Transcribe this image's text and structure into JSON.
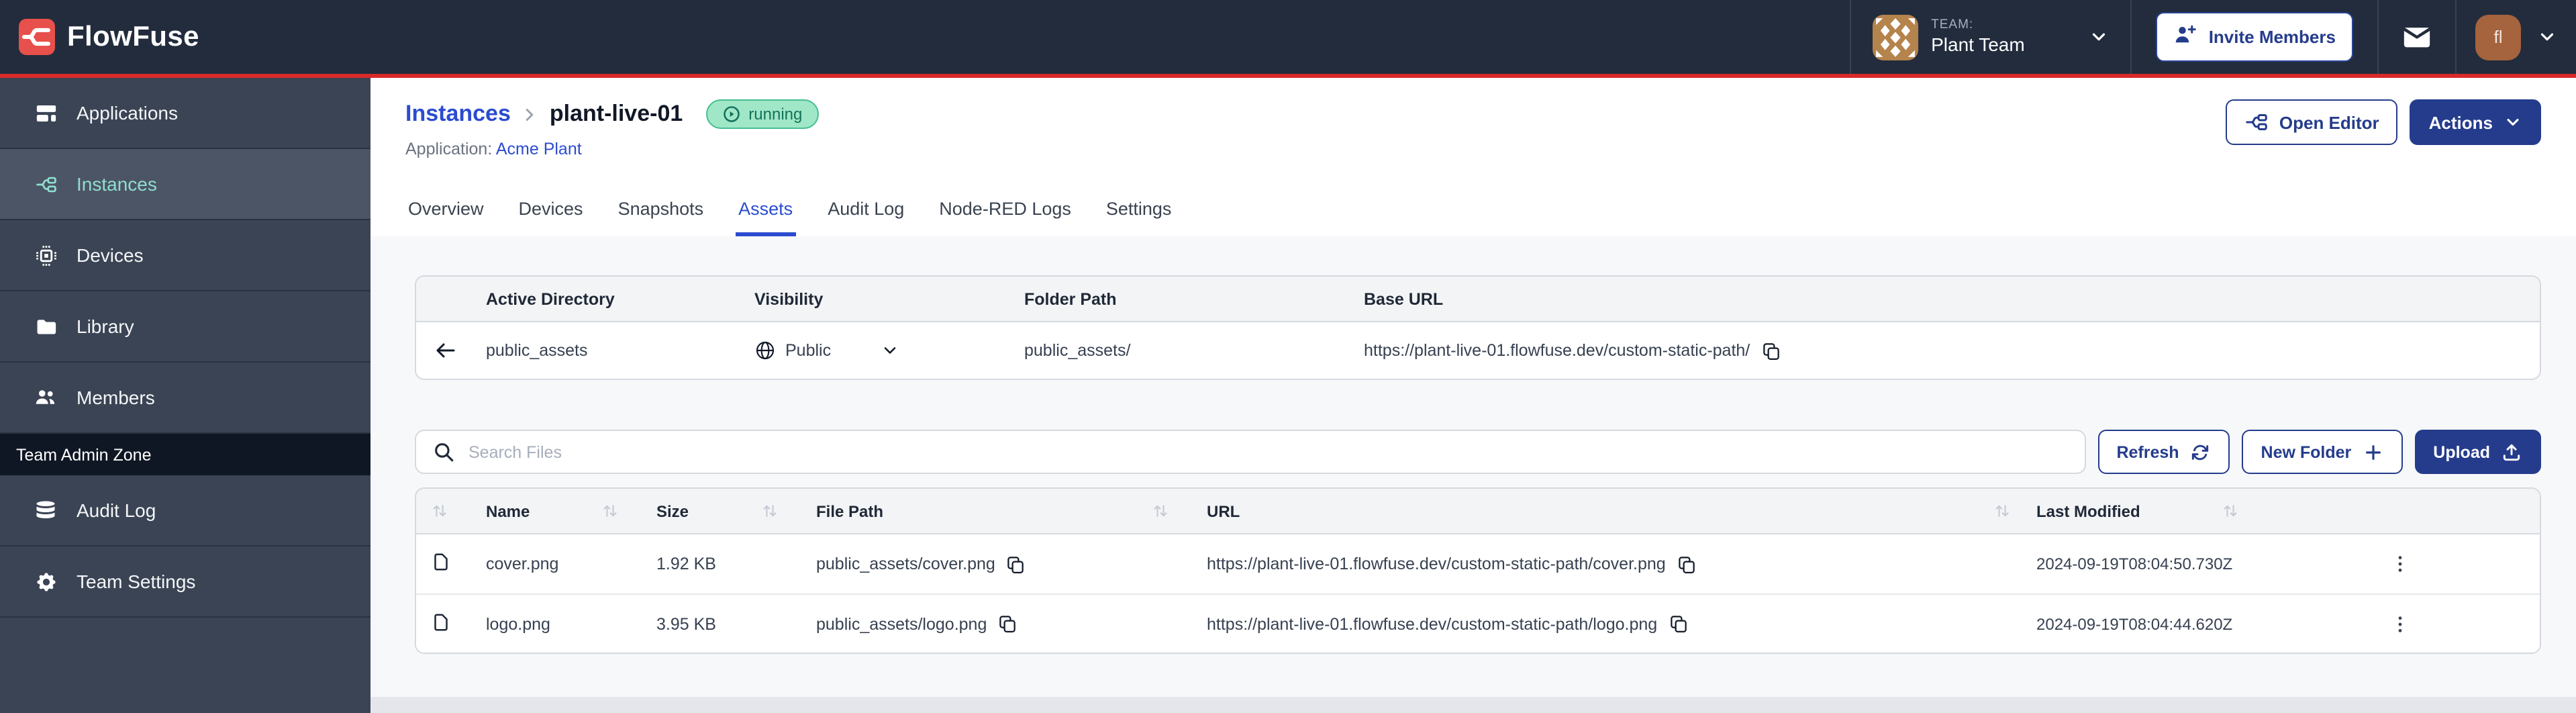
{
  "brand": {
    "name": "FlowFuse"
  },
  "header": {
    "team_label": "TEAM:",
    "team_name": "Plant Team",
    "invite_button": "Invite Members",
    "user_initials": "fl"
  },
  "sidebar": {
    "items": [
      {
        "label": "Applications"
      },
      {
        "label": "Instances",
        "active": true
      },
      {
        "label": "Devices"
      },
      {
        "label": "Library"
      },
      {
        "label": "Members"
      }
    ],
    "admin_zone_label": "Team Admin Zone",
    "admin_items": [
      {
        "label": "Audit Log"
      },
      {
        "label": "Team Settings"
      }
    ]
  },
  "page": {
    "breadcrumb_parent": "Instances",
    "breadcrumb_current": "plant-live-01",
    "status_badge": "running",
    "application_label": "Application:",
    "application_name": "Acme Plant",
    "open_editor_button": "Open Editor",
    "actions_button": "Actions"
  },
  "tabs": [
    {
      "label": "Overview"
    },
    {
      "label": "Devices"
    },
    {
      "label": "Snapshots"
    },
    {
      "label": "Assets",
      "active": true
    },
    {
      "label": "Audit Log"
    },
    {
      "label": "Node-RED Logs"
    },
    {
      "label": "Settings"
    }
  ],
  "storage": {
    "columns": [
      "Active Directory",
      "Visibility",
      "Folder Path",
      "Base URL"
    ],
    "active_directory": "public_assets",
    "visibility": "Public",
    "folder_path": "public_assets/",
    "base_url": "https://plant-live-01.flowfuse.dev/custom-static-path/"
  },
  "toolbar": {
    "search_placeholder": "Search Files",
    "refresh_button": "Refresh",
    "new_folder_button": "New Folder",
    "upload_button": "Upload"
  },
  "files": {
    "columns": [
      "Name",
      "Size",
      "File Path",
      "URL",
      "Last Modified"
    ],
    "rows": [
      {
        "name": "cover.png",
        "size": "1.92 KB",
        "file_path": "public_assets/cover.png",
        "url": "https://plant-live-01.flowfuse.dev/custom-static-path/cover.png",
        "last_modified": "2024-09-19T08:04:50.730Z"
      },
      {
        "name": "logo.png",
        "size": "3.95 KB",
        "file_path": "public_assets/logo.png",
        "url": "https://plant-live-01.flowfuse.dev/custom-static-path/logo.png",
        "last_modified": "2024-09-19T08:04:44.620Z"
      }
    ]
  },
  "colors": {
    "header_bg": "#222C3D",
    "accent_red": "#D92A2A",
    "logo_red": "#E8504C",
    "sidebar_bg": "#3B4454",
    "sidebar_active_bg": "#4C5565",
    "sidebar_active_teal": "#8FDECF",
    "link_blue": "#2B4CD0",
    "button_navy": "#253C8C",
    "status_green_bg": "#9FE7C7",
    "status_green_border": "#46BE92",
    "status_green_text": "#15725B"
  }
}
